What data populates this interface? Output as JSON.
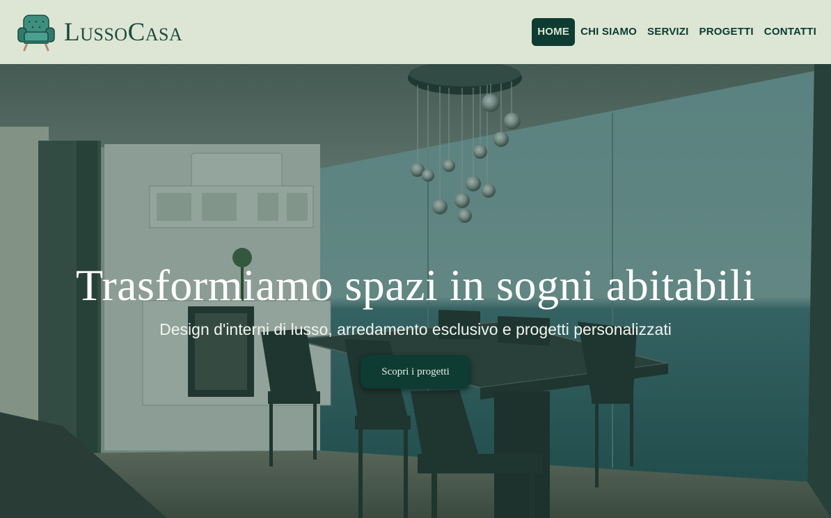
{
  "brand": {
    "name": "LussoCasa",
    "icon": "armchair-icon"
  },
  "nav": {
    "items": [
      {
        "label": "HOME",
        "active": true
      },
      {
        "label": "CHI SIAMO",
        "active": false
      },
      {
        "label": "SERVIZI",
        "active": false
      },
      {
        "label": "PROGETTI",
        "active": false
      },
      {
        "label": "CONTATTI",
        "active": false
      }
    ]
  },
  "hero": {
    "title": "Trasformiamo spazi in sogni abitabili",
    "subtitle": "Design d'interni di lusso, arredamento esclusivo e progetti personalizzati",
    "cta_label": "Scopri i progetti",
    "background": "dining-room-sea-view-image"
  },
  "colors": {
    "header_bg": "#dde6d4",
    "accent": "#0e3b32",
    "brand_text": "#1d4a3f",
    "overlay": "#103a30"
  }
}
